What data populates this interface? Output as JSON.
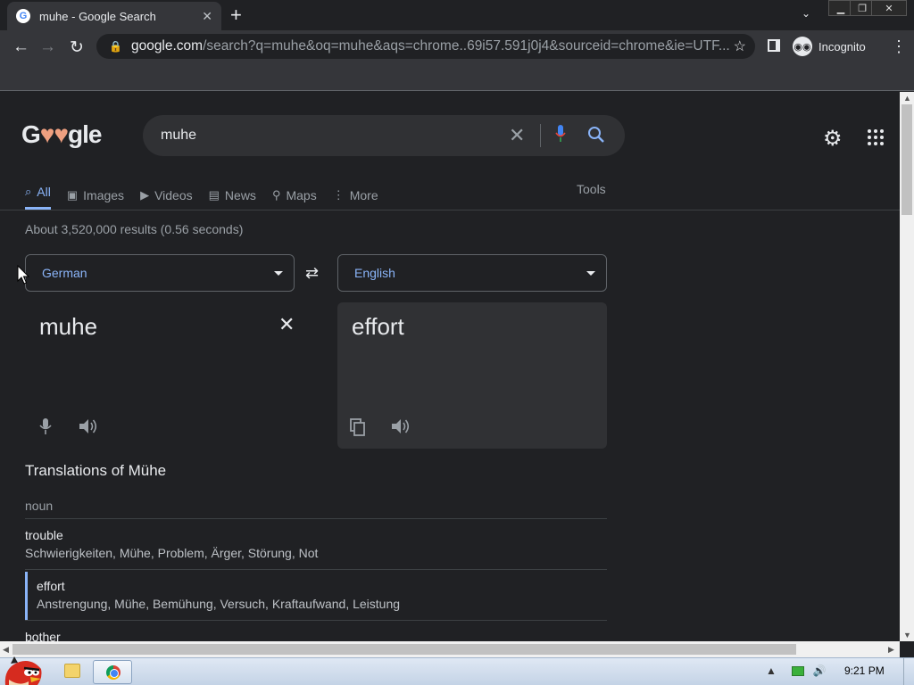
{
  "browser": {
    "tab_title": "muhe - Google Search",
    "tab_close": "✕",
    "new_tab": "+",
    "url_host": "google.com",
    "url_path": "/search?q=muhe&oq=muhe&aqs=chrome..69i57.591j0j4&sourceid=chrome&ie=UTF...",
    "incognito_label": "Incognito",
    "window_minimize": "▁",
    "window_restore": "❐",
    "window_close": "✕"
  },
  "search": {
    "query": "muhe",
    "tabs": [
      {
        "label": "All",
        "icon": "search-icon"
      },
      {
        "label": "Images",
        "icon": "image-icon"
      },
      {
        "label": "Videos",
        "icon": "video-icon"
      },
      {
        "label": "News",
        "icon": "news-icon"
      },
      {
        "label": "Maps",
        "icon": "map-pin-icon"
      },
      {
        "label": "More",
        "icon": "more-vert-icon"
      }
    ],
    "tools_label": "Tools",
    "result_stats": "About 3,520,000 results (0.56 seconds)"
  },
  "translate": {
    "source_lang": "German",
    "target_lang": "English",
    "source_text": "muhe",
    "target_text": "effort",
    "translations_heading": "Translations of Mühe",
    "part_of_speech": "noun",
    "entries": [
      {
        "word": "trouble",
        "synonyms": "Schwierigkeiten, Mühe, Problem, Ärger, Störung, Not"
      },
      {
        "word": "effort",
        "synonyms": "Anstrengung, Mühe, Bemühung, Versuch, Kraftaufwand, Leistung"
      },
      {
        "word": "bother",
        "synonyms": ""
      }
    ]
  },
  "taskbar": {
    "clock": "9:21 PM"
  },
  "colors": {
    "page_bg": "#202124",
    "accent_blue": "#8ab4f8",
    "panel_bg": "#303134"
  }
}
